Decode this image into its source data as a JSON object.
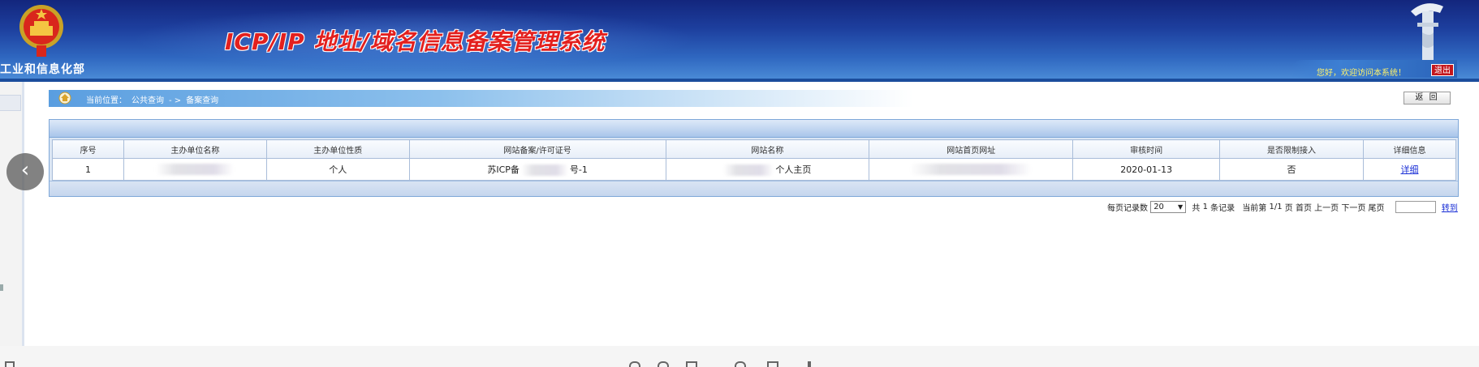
{
  "header": {
    "ministry_name": "工业和信息化部",
    "system_title": "ICP/IP 地址/域名信息备案管理系统",
    "welcome_text": "您好，欢迎访问本系统！",
    "logout_label": "退出",
    "emblem_icon": "national-emblem-icon",
    "pillar_icon": "huabiao-pillar-icon",
    "colors": {
      "banner": "#1d3f9e",
      "title": "#e3201e",
      "welcome": "#fff36b",
      "logout": "#c4161c"
    }
  },
  "left_frame": {
    "back_button_icon": "chevron-left-icon",
    "back_glyph": "‹"
  },
  "breadcrumb": {
    "home_icon": "home-icon",
    "location_label": "当前位置：",
    "level1": "公共查询",
    "separator": "- >",
    "level2": "备案查询"
  },
  "return_button": {
    "label": "返 回"
  },
  "results_table": {
    "columns": [
      "序号",
      "主办单位名称",
      "主办单位性质",
      "网站备案/许可证号",
      "网站名称",
      "网站首页网址",
      "审核时间",
      "是否限制接入",
      "详细信息"
    ],
    "rows": [
      {
        "index": "1",
        "organizer_name": "",
        "organizer_type": "个人",
        "license_prefix": "苏ICP备",
        "license_suffix": "号-1",
        "site_name_suffix": "个人主页",
        "homepage_url": "",
        "audit_date": "2020-01-13",
        "restricted": "否",
        "detail_link": "详细"
      }
    ]
  },
  "pagination": {
    "per_page_label": "每页记录数",
    "per_page_value": "20",
    "total_prefix": "共",
    "total_count": "1",
    "total_suffix": "条记录",
    "current_label": "当前第",
    "page_position": "1/1",
    "page_unit": "页",
    "first_label": "首页",
    "prev_label": "上一页",
    "next_label": "下一页",
    "last_label": "尾页",
    "jump_label": "转到"
  }
}
